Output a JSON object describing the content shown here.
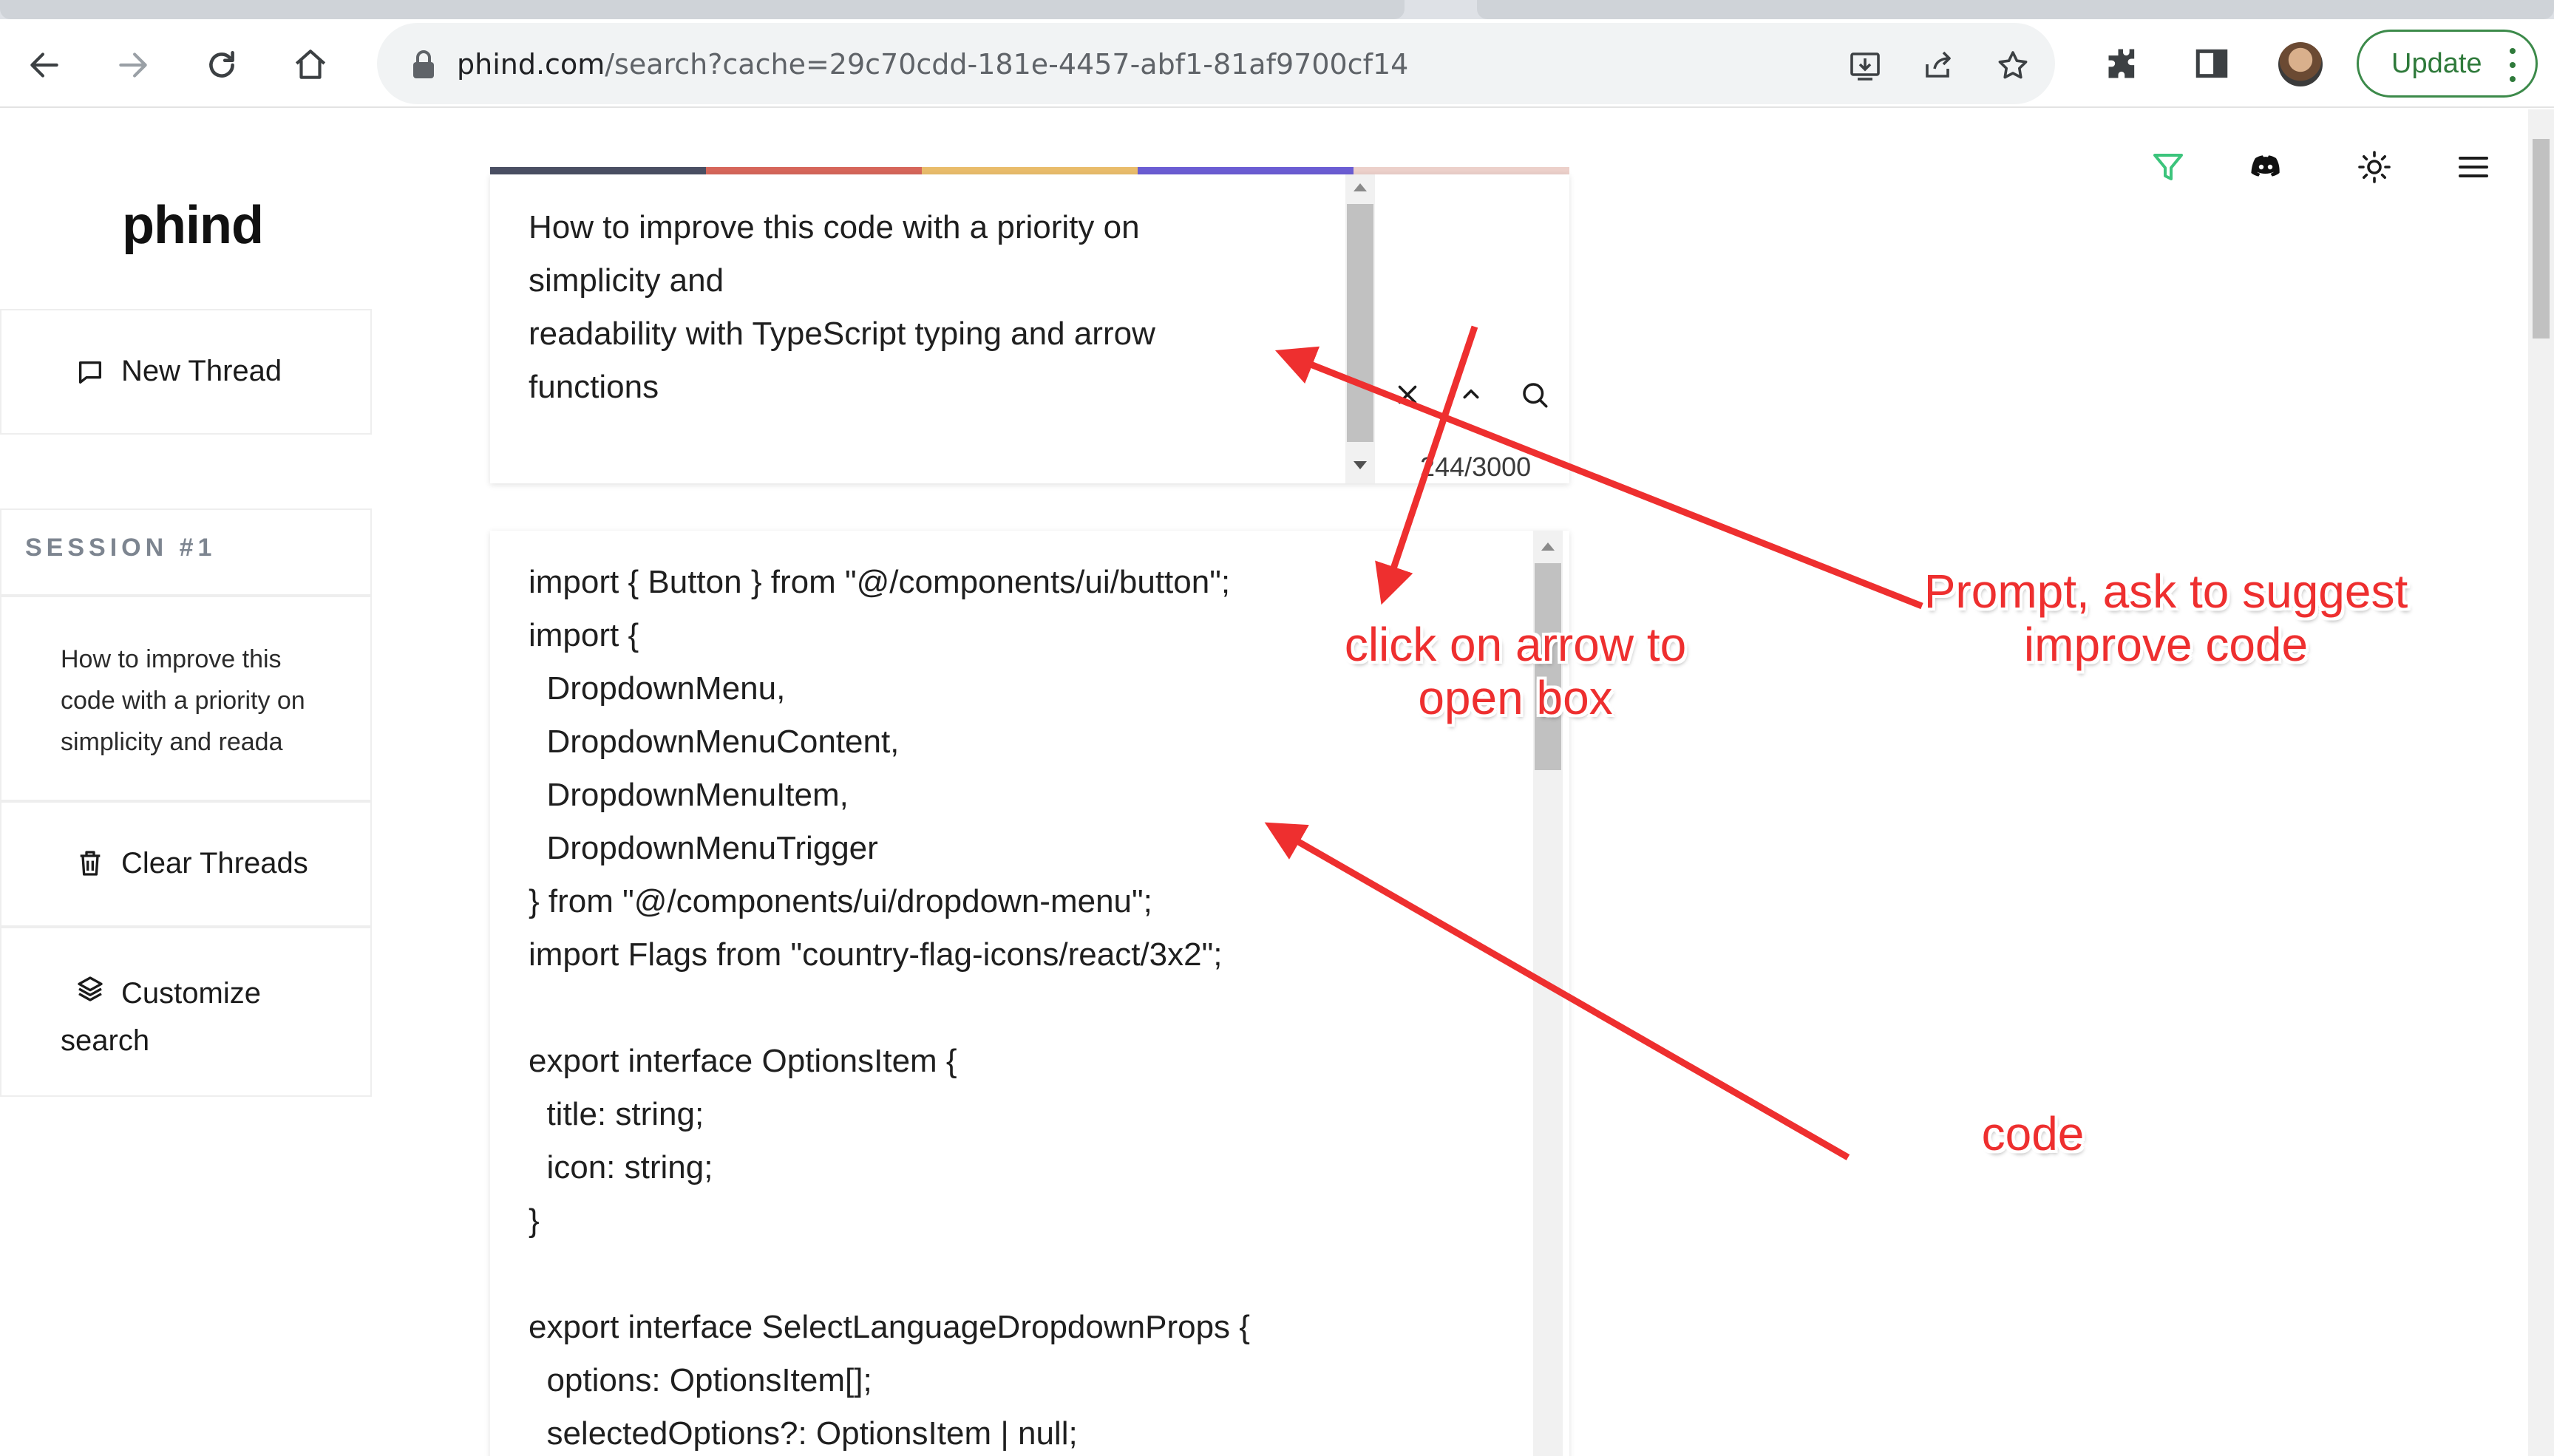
{
  "browser": {
    "url_host": "phind.com",
    "url_path": "/search?cache=29c70cdd-181e-4457-abf1-81af9700cf14",
    "update_label": "Update",
    "icons": [
      "back-icon",
      "forward-icon",
      "reload-icon",
      "home-icon",
      "lock-icon",
      "install-icon",
      "share-icon",
      "bookmark-star-icon",
      "extensions-puzzle-icon",
      "side-panel-icon",
      "profile-avatar",
      "menu-kebab-icon"
    ]
  },
  "sidebar": {
    "logo": "phind",
    "new_thread": "New Thread",
    "session_title": "SESSION #1",
    "session_item": "How to improve this code with a priority on simplicity and reada",
    "clear_threads": "Clear Threads",
    "customize_search": "Customize search"
  },
  "topbar": {
    "icons": [
      "filter-icon",
      "discord-icon",
      "theme-sun-icon",
      "hamburger-menu-icon"
    ],
    "filter_color": "#3cc47c"
  },
  "prompt": {
    "lines": [
      "How to improve this code with a priority on",
      "simplicity and",
      "readability with TypeScript typing and arrow",
      "functions"
    ],
    "char_count": "244/3000",
    "rainbow_colors": [
      "#4a4f63",
      "#d6665a",
      "#e9bc6b",
      "#6b5dd3",
      "#ecd0ca"
    ]
  },
  "code": {
    "lines": [
      "import { Button } from \"@/components/ui/button\";",
      "import {",
      "  DropdownMenu,",
      "  DropdownMenuContent,",
      "  DropdownMenuItem,",
      "  DropdownMenuTrigger",
      "} from \"@/components/ui/dropdown-menu\";",
      "import Flags from \"country-flag-icons/react/3x2\";",
      "",
      "export interface OptionsItem {",
      "  title: string;",
      "  icon: string;",
      "}",
      "",
      "export interface SelectLanguageDropdownProps {",
      "  options: OptionsItem[];",
      "  selectedOptions?: OptionsItem | null;"
    ]
  },
  "annotations": {
    "prompt_note": [
      "Prompt, ask to suggest",
      "improve code"
    ],
    "arrow_note": [
      "click on arrow to",
      "open box"
    ],
    "code_note": "code",
    "color": "#ee2f2f"
  }
}
